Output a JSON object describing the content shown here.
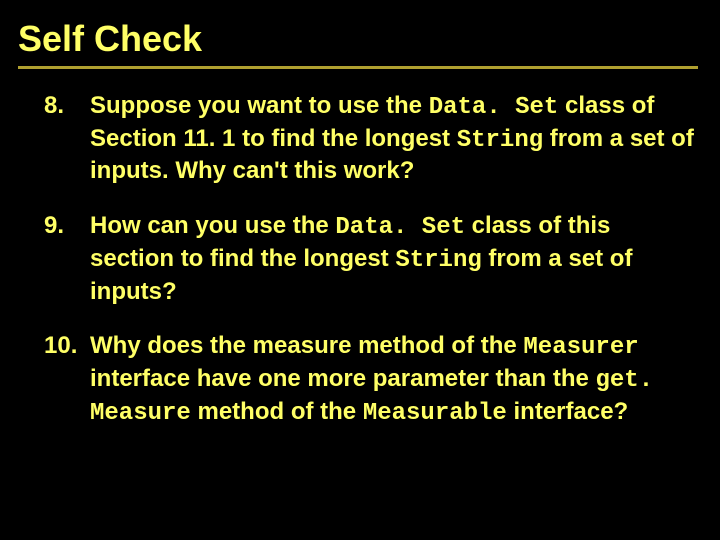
{
  "title": "Self Check",
  "items": [
    {
      "num": "8.",
      "pre1": "Suppose you want to use the ",
      "code1": "Data. Set",
      "mid1": " class of Section 11. 1 to find the longest ",
      "code2": "String",
      "post1": " from a set of inputs. Why can't this work?"
    },
    {
      "num": "9.",
      "pre1": "How can you use the ",
      "code1": "Data. Set",
      "mid1": " class of this section to find the longest ",
      "code2": "String",
      "post1": " from a set of inputs?"
    },
    {
      "num": "10.",
      "pre1": "Why does the measure method of the ",
      "code1": "Measurer",
      "mid1": " interface have one more parameter than the ",
      "code2": "get. Measure",
      "mid2": " method of the ",
      "code3": "Measurable",
      "post1": " interface?"
    }
  ]
}
